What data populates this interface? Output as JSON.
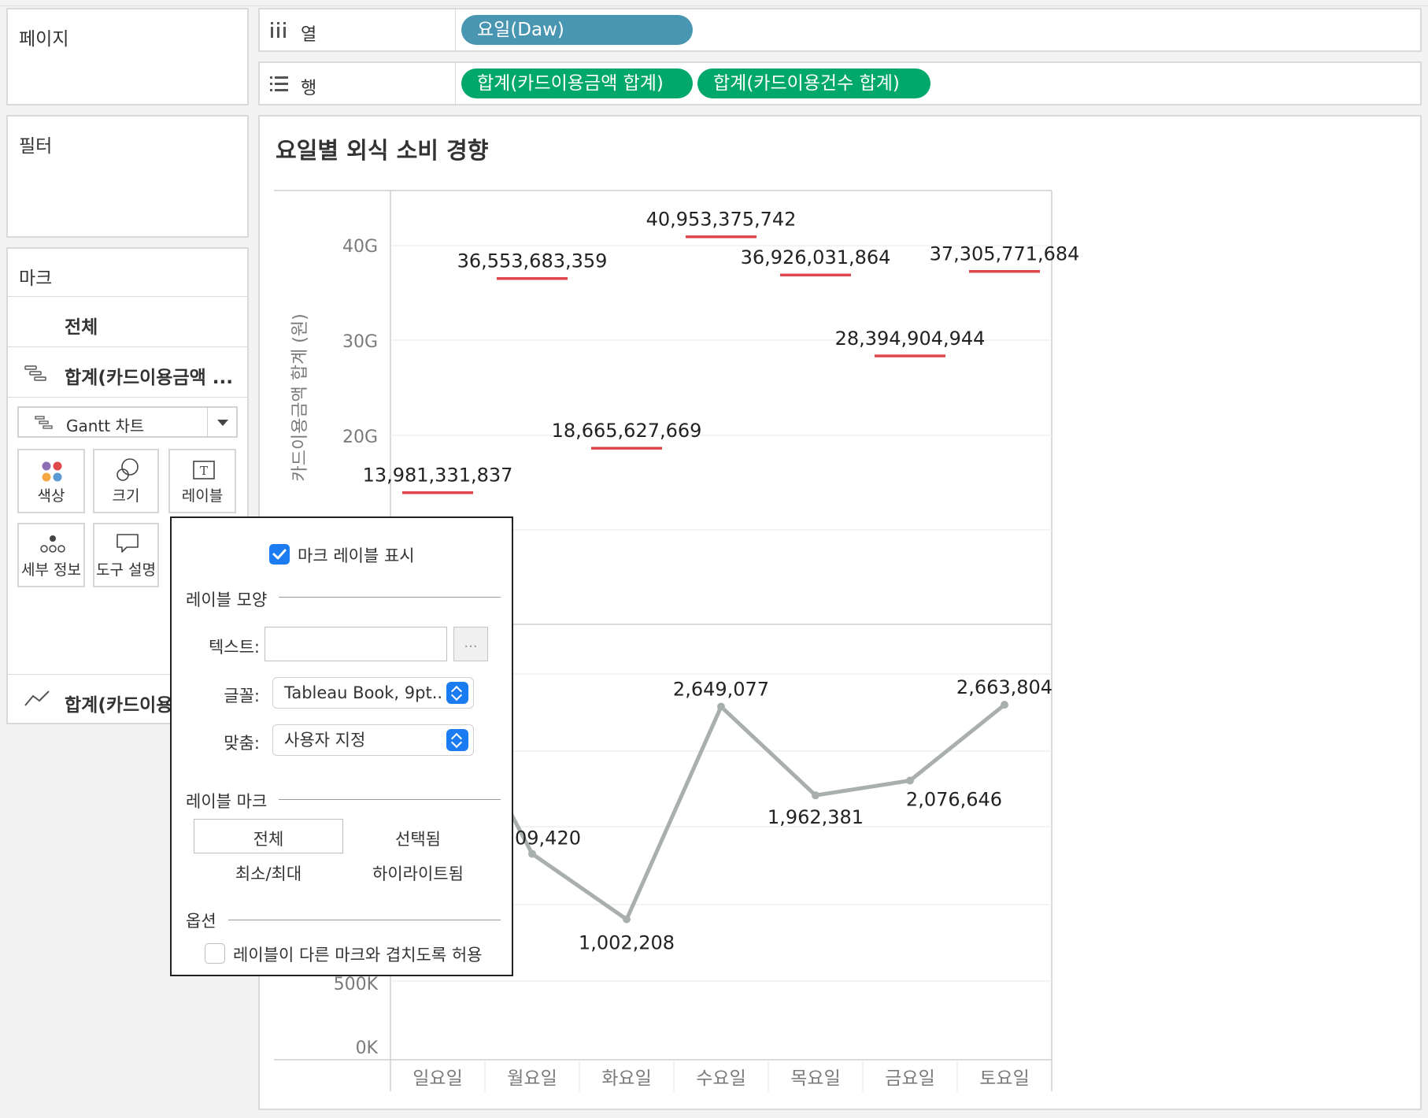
{
  "left": {
    "pages_title": "페이지",
    "filters_title": "필터",
    "marks_title": "마크",
    "marks_all": "전체",
    "marks_measure1": "합계(카드이용금액 ...",
    "mark_type": "Gantt 차트",
    "cards": [
      {
        "icon": "color-dots-icon",
        "label": "색상"
      },
      {
        "icon": "size-icon",
        "label": "크기"
      },
      {
        "icon": "label-icon",
        "label": "레이블"
      },
      {
        "icon": "detail-icon",
        "label": "세부 정보"
      },
      {
        "icon": "tooltip-icon",
        "label": "도구 설명"
      }
    ],
    "marks_measure2": "합계(카드이용"
  },
  "shelves": {
    "columns_label": "열",
    "rows_label": "행",
    "columns_pill": "요일(Daw)",
    "rows_pills": [
      "합계(카드이용금액 합계)",
      "합계(카드이용건수 합계)"
    ]
  },
  "colors": {
    "dimension_pill": "#4996b2",
    "measure_pill": "#00a86b",
    "gantt_mark": "#e0474c",
    "line_mark": "#a9afad",
    "checkbox": "#1a7cf0"
  },
  "chart": {
    "title": "요일별 외식 소비 경향",
    "y1_title": "카드이용금액 합계 (원)",
    "y1_ticks": [
      "40G",
      "30G",
      "20G"
    ],
    "y2_ticks": [
      "500K",
      "0K"
    ],
    "categories": [
      "일요일",
      "월요일",
      "화요일",
      "수요일",
      "목요일",
      "금요일",
      "토요일"
    ]
  },
  "chart_data": [
    {
      "type": "gantt",
      "title": "요일별 외식 소비 경향",
      "ylabel": "카드이용금액 합계 (원)",
      "categories": [
        "일요일",
        "월요일",
        "화요일",
        "수요일",
        "목요일",
        "금요일",
        "토요일"
      ],
      "values": [
        13981331837,
        36553683359,
        18665627669,
        40953375742,
        36926031864,
        28394904944,
        37305771684
      ],
      "labels": [
        "13,981,331,837",
        "36,553,683,359",
        "18,665,627,669",
        "40,953,375,742",
        "36,926,031,864",
        "28,394,904,944",
        "37,305,771,684"
      ],
      "ylim": [
        0,
        45000000000
      ]
    },
    {
      "type": "line",
      "categories": [
        "일요일",
        "월요일",
        "화요일",
        "수요일",
        "목요일",
        "금요일",
        "토요일"
      ],
      "values": [
        null,
        1509420,
        1002208,
        2649077,
        1962381,
        2076646,
        2663804
      ],
      "labels": [
        "",
        "09,420",
        "1,002,208",
        "2,649,077",
        "1,962,381",
        "2,076,646",
        "2,663,804"
      ],
      "yticks": [
        "500K",
        "0K"
      ]
    }
  ],
  "popup": {
    "show_labels": "마크 레이블 표시",
    "appearance_title": "레이블 모양",
    "text_label": "텍스트:",
    "text_value": "",
    "more_button": "...",
    "font_label": "글꼴:",
    "font_value": "Tableau Book, 9pt..",
    "align_label": "맞춤:",
    "align_value": "사용자 지정",
    "marks_title": "레이블 마크",
    "seg_all": "전체",
    "seg_selected": "선택됨",
    "seg_minmax": "최소/최대",
    "seg_highlighted": "하이라이트됨",
    "options_title": "옵션",
    "allow_overlap": "레이블이 다른 마크와 겹치도록 허용"
  }
}
